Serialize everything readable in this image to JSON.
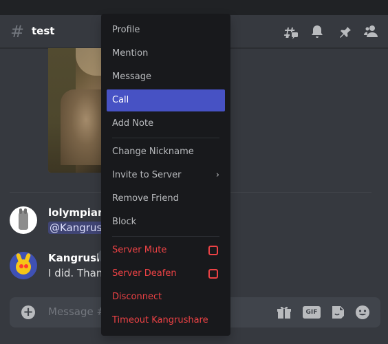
{
  "channel": {
    "name": "test",
    "hash": "#"
  },
  "messages": [
    {
      "author": "lolympian",
      "mention": "@Kangrush"
    },
    {
      "author": "Kangrushar",
      "text": "I did. Thank"
    }
  ],
  "composer": {
    "placeholder": "Message #t",
    "gif_label": "GIF"
  },
  "context_menu": {
    "items": [
      {
        "label": "Profile"
      },
      {
        "label": "Mention"
      },
      {
        "label": "Message"
      },
      {
        "label": "Call"
      },
      {
        "label": "Add Note"
      },
      {
        "label": "Change Nickname"
      },
      {
        "label": "Invite to Server",
        "chevron": "›"
      },
      {
        "label": "Remove Friend"
      },
      {
        "label": "Block"
      },
      {
        "label": "Server Mute"
      },
      {
        "label": "Server Deafen"
      },
      {
        "label": "Disconnect"
      },
      {
        "label": "Timeout Kangrushare"
      }
    ]
  },
  "colors": {
    "accent": "#4752c4",
    "danger": "#ed4245",
    "background": "#36393f",
    "menu": "#18191c"
  },
  "icons": [
    "threads-icon",
    "bell-icon",
    "pin-icon",
    "members-icon",
    "plus-icon",
    "gift-icon",
    "gif-icon",
    "sticker-icon",
    "emoji-icon"
  ]
}
